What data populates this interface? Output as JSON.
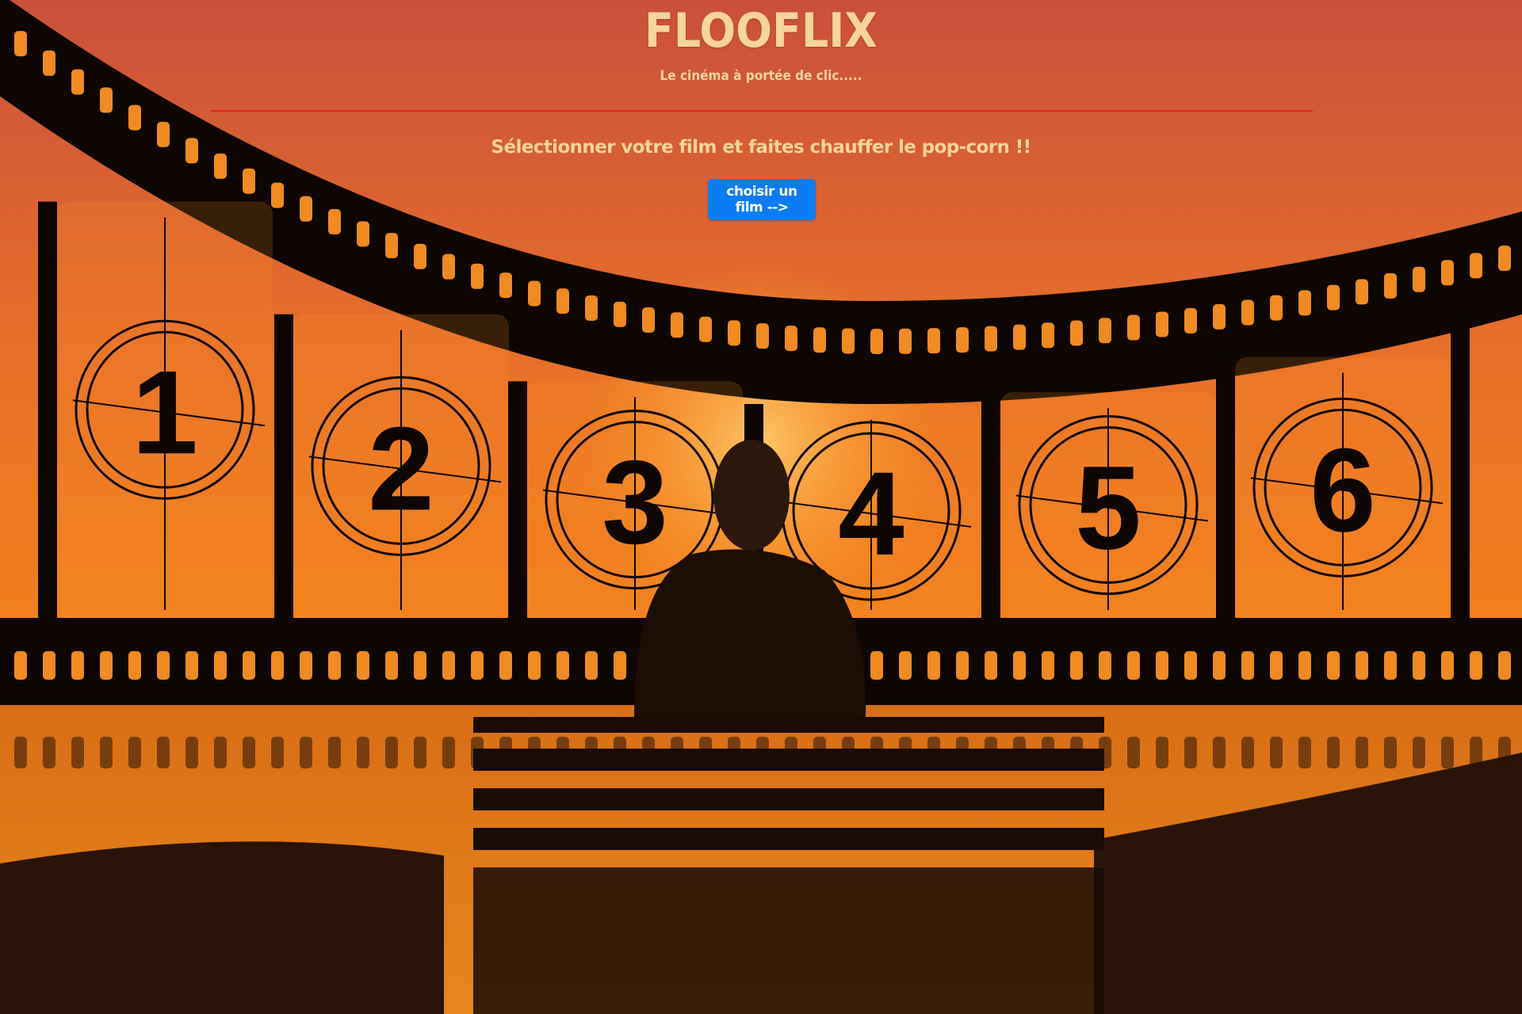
{
  "header": {
    "brand": "FLOOFLIX",
    "tagline": "Le cinéma à portée de clic.....",
    "prompt": "Sélectionner votre film et faites chauffer le pop-corn !!"
  },
  "cta": {
    "label": "choisir un film -->"
  },
  "background": {
    "countdown_frames": [
      "1",
      "2",
      "3",
      "4",
      "5",
      "6"
    ],
    "colors": {
      "sky_top": "#c9503c",
      "sky_mid": "#f07a1c",
      "horizon": "#f29a2a",
      "water": "#e27a1a",
      "film": "#0d0603",
      "divider": "#e2221a",
      "button": "#0d7cf3",
      "text": "#f7d49c"
    }
  }
}
